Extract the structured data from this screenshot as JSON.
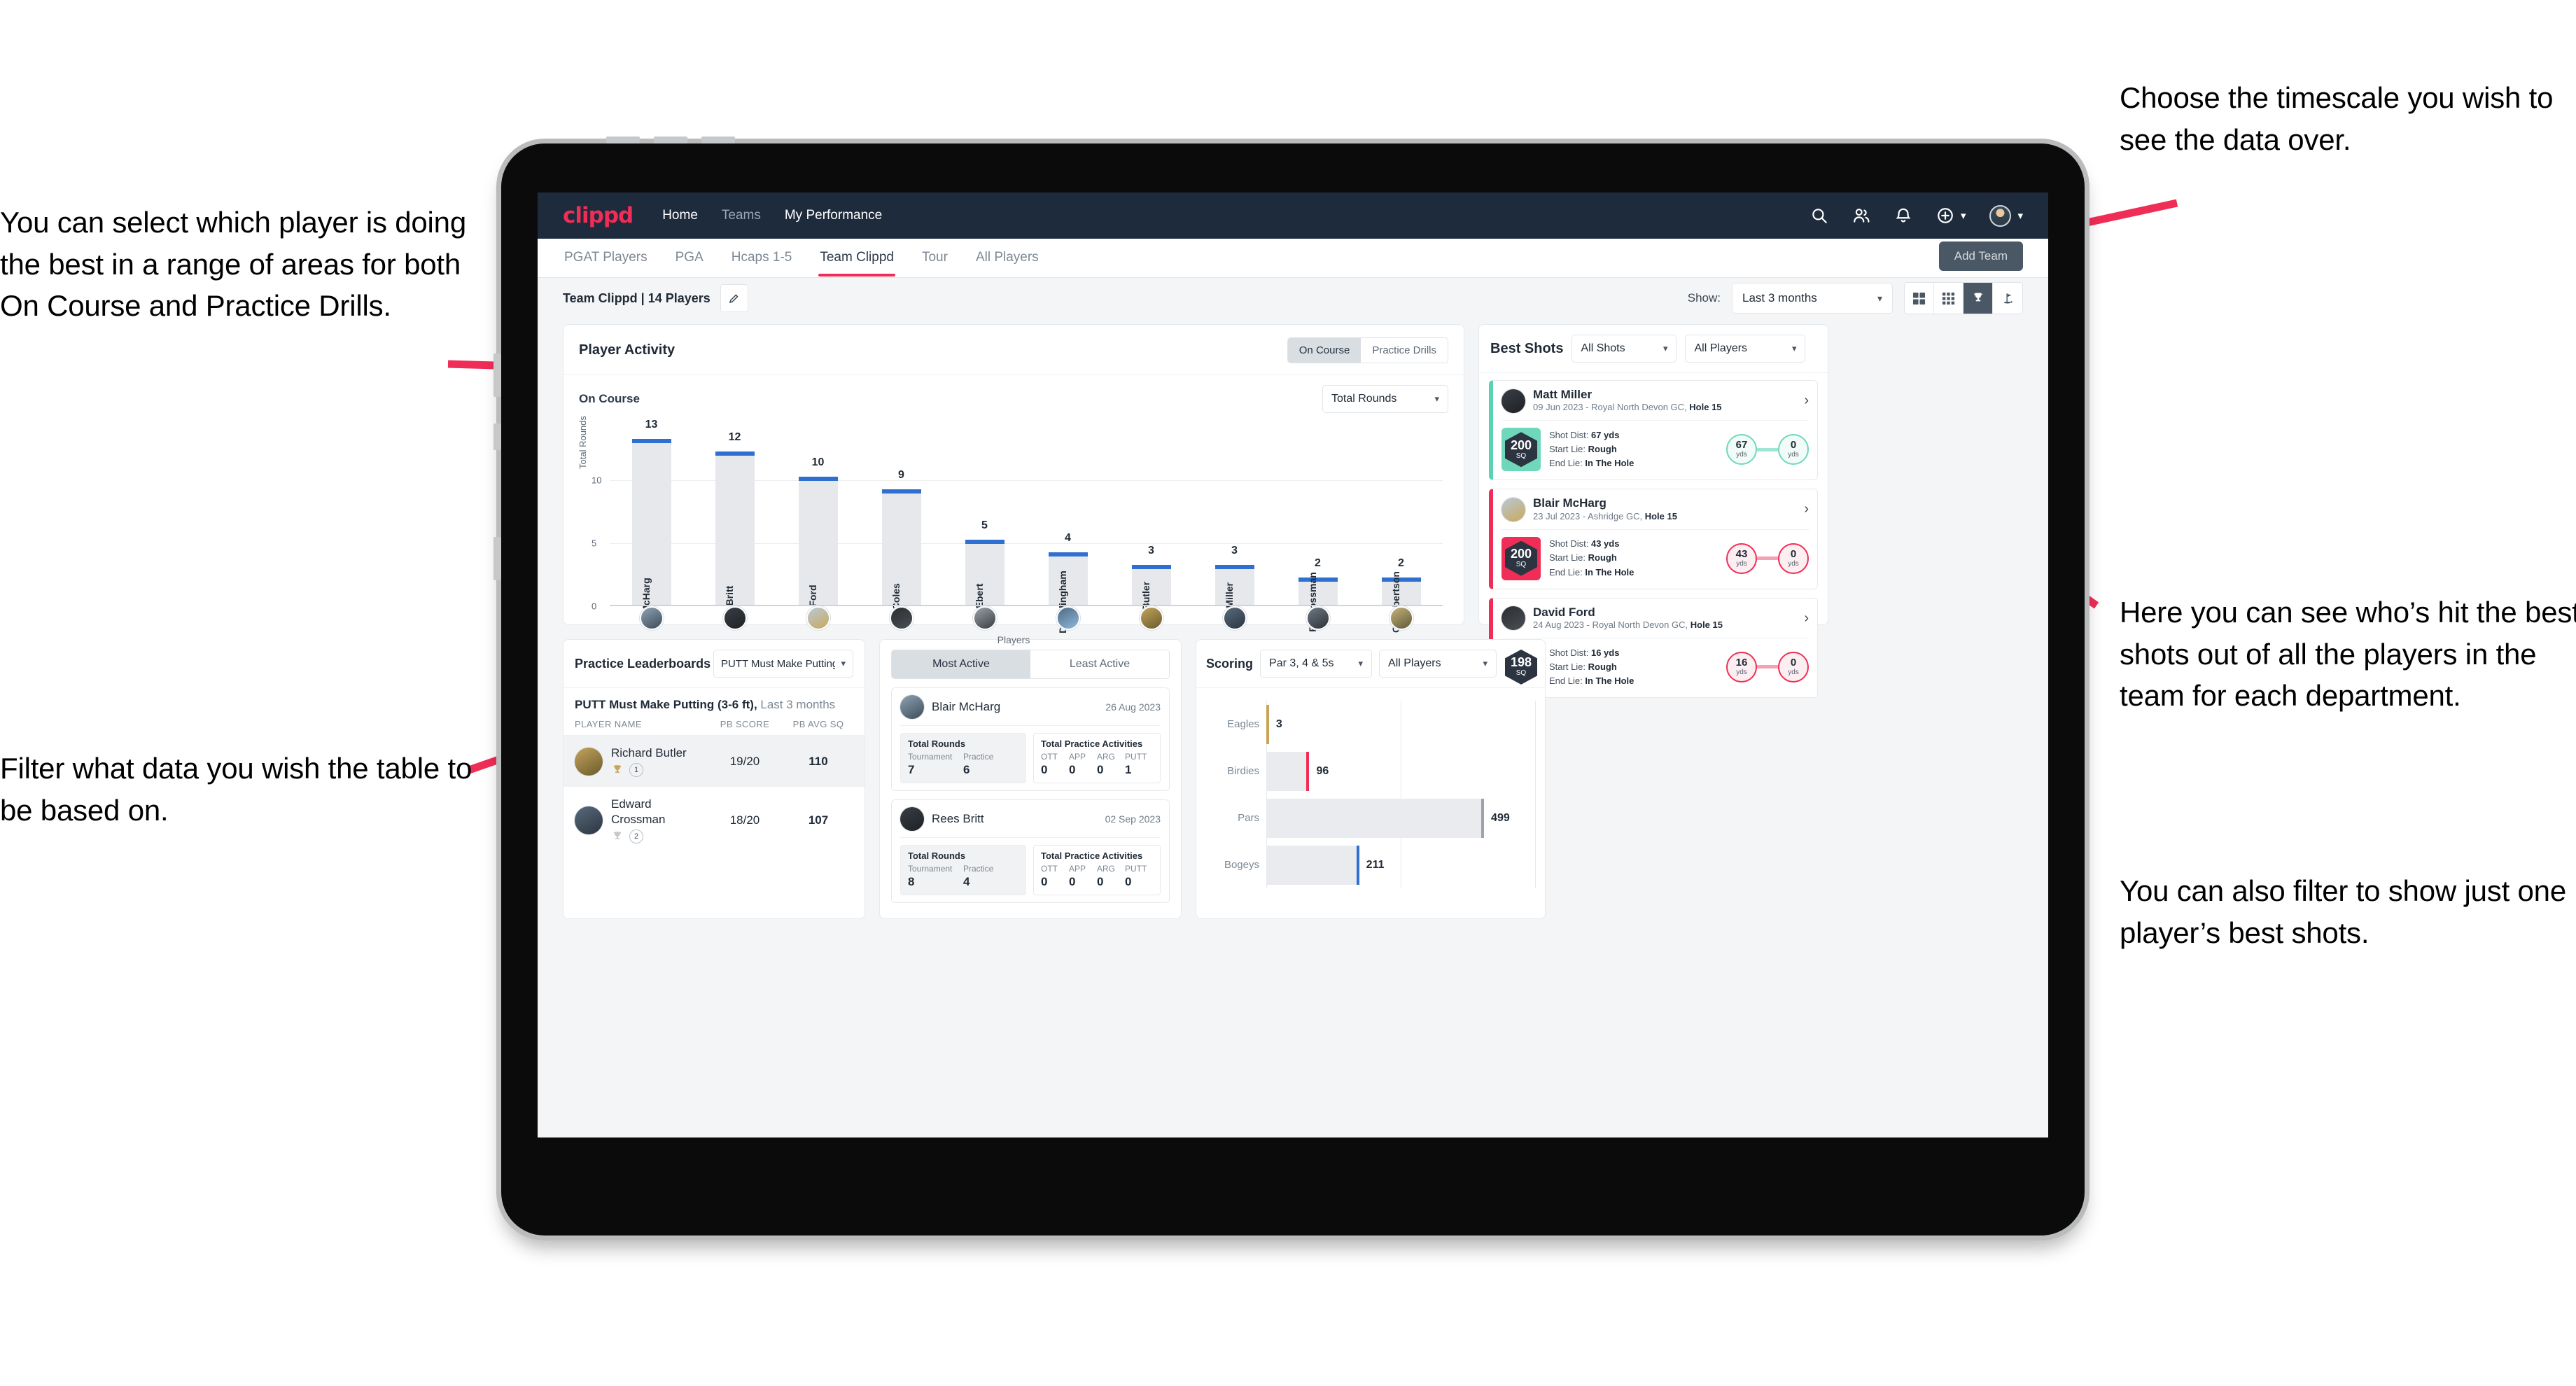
{
  "annotations": {
    "left_top": "You can select which player is doing the best in a range of areas for both On Course and Practice Drills.",
    "left_bottom": "Filter what data you wish the table to be based on.",
    "right_top": "Choose the timescale you wish to see the data over.",
    "right_middle": "Here you can see who’s hit the best shots out of all the players in the team for each department.",
    "right_bottom": "You can also filter to show just one player’s best shots."
  },
  "navbar": {
    "logo": "clippd",
    "links": [
      {
        "label": "Home",
        "active": true
      },
      {
        "label": "Teams",
        "active": false
      },
      {
        "label": "My Performance",
        "active": true
      }
    ],
    "icons": [
      "search-icon",
      "people-icon",
      "bell-icon",
      "plus-circle-icon"
    ]
  },
  "subtabs": {
    "items": [
      {
        "label": "PGAT Players",
        "active": false
      },
      {
        "label": "PGA",
        "active": false
      },
      {
        "label": "Hcaps 1-5",
        "active": false
      },
      {
        "label": "Team Clippd",
        "active": true
      },
      {
        "label": "Tour",
        "active": false
      },
      {
        "label": "All Players",
        "active": false
      }
    ],
    "add_team_label": "Add Team"
  },
  "toolbar": {
    "team_label": "Team Clippd | 14 Players",
    "edit_icon": "pencil-icon",
    "show_label": "Show:",
    "timescale_value": "Last 3 months",
    "view_toggles": [
      {
        "icon": "grid-2x2-icon",
        "active": false
      },
      {
        "icon": "grid-3x3-icon",
        "active": false
      },
      {
        "icon": "trophy-icon",
        "active": true
      },
      {
        "icon": "golf-flag-icon",
        "active": false
      }
    ]
  },
  "player_activity": {
    "title": "Player Activity",
    "toggle": [
      {
        "label": "On Course",
        "active": true
      },
      {
        "label": "Practice Drills",
        "active": false
      }
    ],
    "sub_label": "On Course",
    "metric_value": "Total Rounds"
  },
  "chart_data": [
    {
      "type": "bar",
      "title": "Player Activity - On Course",
      "xlabel": "Players",
      "ylabel": "Total Rounds",
      "categories": [
        "B. McHarg",
        "R. Britt",
        "D. Ford",
        "J. Coles",
        "E. Ebert",
        "D. Billingham",
        "R. Butler",
        "M. Miller",
        "E. Crossman",
        "C. Robertson"
      ],
      "values": [
        13,
        12,
        10,
        9,
        5,
        4,
        3,
        3,
        2,
        2
      ],
      "ylim": [
        0,
        14
      ],
      "yticks": [
        0,
        5,
        10
      ],
      "grid": true,
      "bar_color": "#e6e8eb",
      "cap_color": "#2f6fd0"
    },
    {
      "type": "bar",
      "title": "Scoring",
      "orientation": "horizontal",
      "categories": [
        "Eagles",
        "Birdies",
        "Pars",
        "Bogeys"
      ],
      "values": [
        3,
        96,
        499,
        211
      ],
      "colors": [
        "#c9a356",
        "#ef2d56",
        "#9ca3ab",
        "#2f6fd0"
      ],
      "xlim": [
        0,
        620
      ],
      "grid": true
    }
  ],
  "best_shots": {
    "title": "Best Shots",
    "filter_shots": "All Shots",
    "filter_players": "All Players",
    "shots": [
      {
        "name": "Matt Miller",
        "meta_prefix": "09 Jun 2023 - Royal North Devon GC, ",
        "hole": "Hole 15",
        "badge_value": "200",
        "badge_unit": "SQ",
        "accent": "teal",
        "shot_dist_label": "Shot Dist: ",
        "shot_dist": "67 yds",
        "start_lie_label": "Start Lie: ",
        "start_lie": "Rough",
        "end_lie_label": "End Lie: ",
        "end_lie": "In The Hole",
        "from_value": "67",
        "from_unit": "yds",
        "to_value": "0",
        "to_unit": "yds"
      },
      {
        "name": "Blair McHarg",
        "meta_prefix": "23 Jul 2023 - Ashridge GC, ",
        "hole": "Hole 15",
        "badge_value": "200",
        "badge_unit": "SQ",
        "accent": "pink",
        "shot_dist_label": "Shot Dist: ",
        "shot_dist": "43 yds",
        "start_lie_label": "Start Lie: ",
        "start_lie": "Rough",
        "end_lie_label": "End Lie: ",
        "end_lie": "In The Hole",
        "from_value": "43",
        "from_unit": "yds",
        "to_value": "0",
        "to_unit": "yds"
      },
      {
        "name": "David Ford",
        "meta_prefix": "24 Aug 2023 - Royal North Devon GC, ",
        "hole": "Hole 15",
        "badge_value": "198",
        "badge_unit": "SQ",
        "accent": "pink",
        "shot_dist_label": "Shot Dist: ",
        "shot_dist": "16 yds",
        "start_lie_label": "Start Lie: ",
        "start_lie": "Rough",
        "end_lie_label": "End Lie: ",
        "end_lie": "In The Hole",
        "from_value": "16",
        "from_unit": "yds",
        "to_value": "0",
        "to_unit": "yds"
      }
    ]
  },
  "practice_leaderboards": {
    "title": "Practice Leaderboards",
    "drill_select": "PUTT Must Make Putting ...",
    "subtitle_bold": "PUTT Must Make Putting (3-6 ft),",
    "subtitle_light": " Last 3 months",
    "columns": [
      "PLAYER NAME",
      "PB SCORE",
      "PB AVG SQ"
    ],
    "rows": [
      {
        "name": "Richard Butler",
        "rank": "1",
        "trophy": "gold",
        "pb_score": "19/20",
        "pb_avg_sq": "110",
        "highlighted": true
      },
      {
        "name": "Edward Crossman",
        "rank": "2",
        "trophy": "silver",
        "pb_score": "18/20",
        "pb_avg_sq": "107",
        "highlighted": false
      }
    ]
  },
  "activity_panel": {
    "tabs": [
      {
        "label": "Most Active",
        "active": true
      },
      {
        "label": "Least Active",
        "active": false
      }
    ],
    "rounds_title": "Total Rounds",
    "practice_title": "Total Practice Activities",
    "rounds_cols": [
      "Tournament",
      "Practice"
    ],
    "practice_cols": [
      "OTT",
      "APP",
      "ARG",
      "PUTT"
    ],
    "items": [
      {
        "name": "Blair McHarg",
        "date": "26 Aug 2023",
        "rounds": [
          "7",
          "6"
        ],
        "practice": [
          "0",
          "0",
          "0",
          "1"
        ]
      },
      {
        "name": "Rees Britt",
        "date": "02 Sep 2023",
        "rounds": [
          "8",
          "4"
        ],
        "practice": [
          "0",
          "0",
          "0",
          "0"
        ]
      }
    ]
  },
  "scoring": {
    "title": "Scoring",
    "filter_par": "Par 3, 4 & 5s",
    "filter_players": "All Players"
  }
}
